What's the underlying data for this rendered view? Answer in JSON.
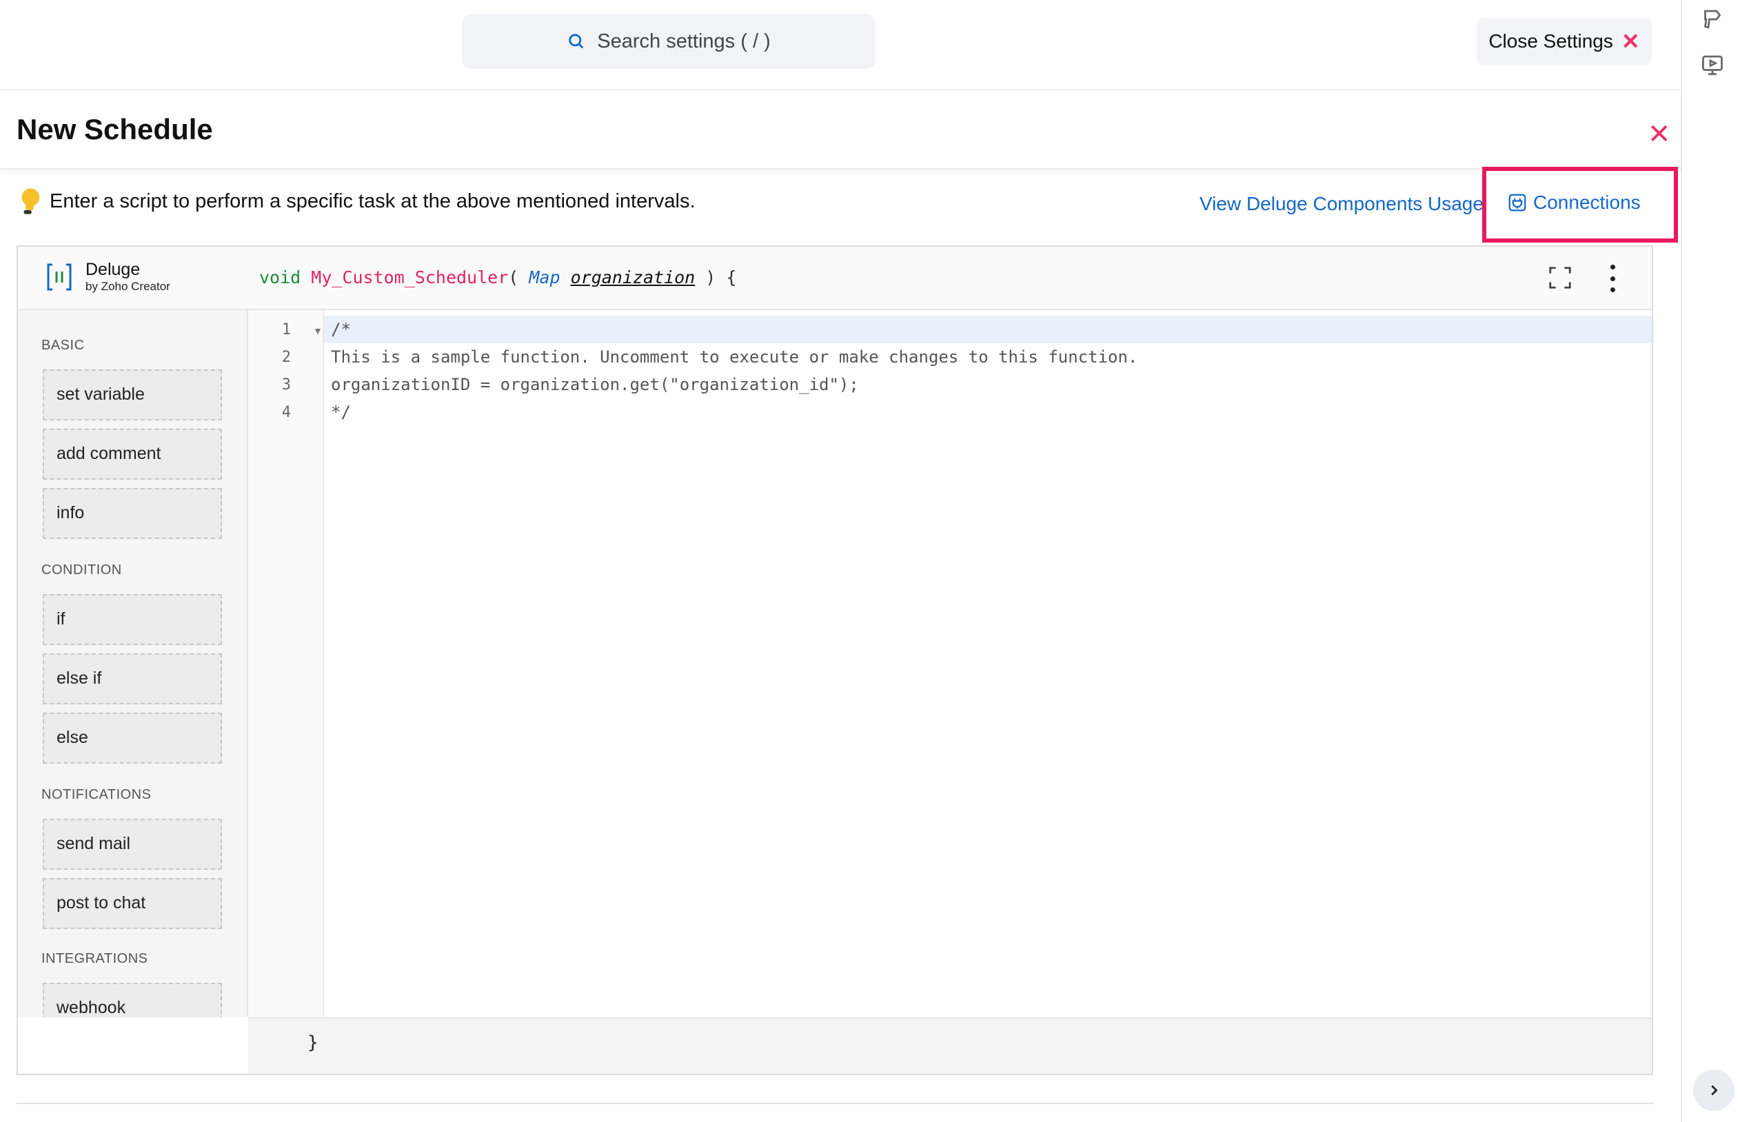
{
  "header": {
    "search_placeholder": "Search settings ( / )",
    "close_settings_label": "Close Settings"
  },
  "panel": {
    "title": "New Schedule",
    "hint": "Enter a script to perform a specific task at the above mentioned intervals.",
    "view_usage_link": "View Deluge Components Usage",
    "connections_link": "Connections"
  },
  "editor": {
    "brand_name": "Deluge",
    "brand_sub": "by Zoho Creator",
    "signature": {
      "return_type": "void",
      "function_name": "My_Custom_Scheduler",
      "open": "( ",
      "param_type": "Map",
      "param_name": "organization",
      "close": " ) {"
    },
    "closing_brace": "}",
    "lines": [
      {
        "number": "1",
        "text": "/*"
      },
      {
        "number": "2",
        "text": "This is a sample function. Uncomment to execute or make changes to this function."
      },
      {
        "number": "3",
        "text": "organizationID = organization.get(\"organization_id\");"
      },
      {
        "number": "4",
        "text": "*/"
      }
    ]
  },
  "palette": {
    "sections": [
      {
        "label": "BASIC",
        "items": [
          "set variable",
          "add comment",
          "info"
        ]
      },
      {
        "label": "CONDITION",
        "items": [
          "if",
          "else if",
          "else"
        ]
      },
      {
        "label": "NOTIFICATIONS",
        "items": [
          "send mail",
          "post to chat"
        ]
      },
      {
        "label": "INTEGRATIONS",
        "items": [
          "webhook"
        ]
      }
    ]
  },
  "icons": {
    "search": "search-icon",
    "close": "close-icon",
    "hint": "lightbulb-icon",
    "connections": "plug-icon",
    "fullscreen": "fullscreen-icon",
    "more": "more-vertical-icon",
    "rail_top": "feedback-icon",
    "rail_video": "video-tutorial-icon",
    "rail_expand": "chevron-right-icon"
  },
  "colors": {
    "accent_pink": "#e8336a",
    "link_blue": "#1467c8",
    "keyword_green": "#1f8a3a",
    "highlight_border": "#e8195f"
  }
}
